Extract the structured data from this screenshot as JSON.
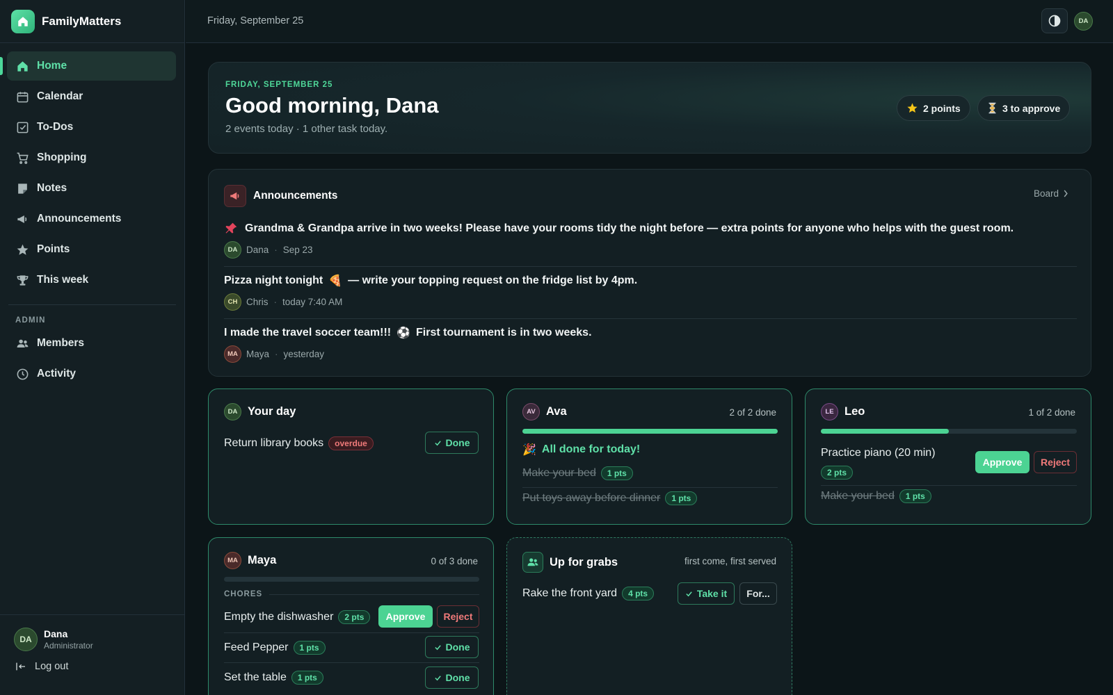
{
  "app": {
    "name": "FamilyMatters"
  },
  "topbar": {
    "date": "Friday, September 25",
    "user_initials": "DA"
  },
  "nav": {
    "items": [
      {
        "label": "Home",
        "icon": "home-icon",
        "active": true
      },
      {
        "label": "Calendar",
        "icon": "calendar-icon"
      },
      {
        "label": "To-Dos",
        "icon": "checkbox-icon"
      },
      {
        "label": "Shopping",
        "icon": "cart-icon"
      },
      {
        "label": "Notes",
        "icon": "note-icon"
      },
      {
        "label": "Announcements",
        "icon": "megaphone-icon"
      },
      {
        "label": "Points",
        "icon": "star-icon"
      },
      {
        "label": "This week",
        "icon": "trophy-icon"
      }
    ],
    "admin_label": "ADMIN",
    "admin_items": [
      {
        "label": "Members",
        "icon": "users-icon"
      },
      {
        "label": "Activity",
        "icon": "clock-icon"
      }
    ]
  },
  "user": {
    "initials": "DA",
    "name": "Dana",
    "role": "Administrator",
    "logout": "Log out"
  },
  "hero": {
    "kicker": "FRIDAY, SEPTEMBER 25",
    "title": "Good morning, Dana",
    "subtitle": "2 events today · 1 other task today.",
    "points": "2 points",
    "approve": "3 to approve"
  },
  "announcements": {
    "title": "Announcements",
    "board_link": "Board",
    "items": [
      {
        "pinned": true,
        "text": "Grandma & Grandpa arrive in two weeks! Please have your rooms tidy the night before — extra points for anyone who helps with the guest room.",
        "initials": "DA",
        "author": "Dana",
        "time": "Sep 23"
      },
      {
        "text_before": "Pizza night tonight",
        "emoji": "🍕",
        "text_after": "— write your topping request on the fridge list by 4pm.",
        "initials": "CH",
        "author": "Chris",
        "time": "today 7:40 AM"
      },
      {
        "text_before": "I made the travel soccer team!!!",
        "emoji": "⚽",
        "text_after": "First tournament is in two weeks.",
        "initials": "MA",
        "author": "Maya",
        "time": "yesterday"
      }
    ]
  },
  "your_day": {
    "initials": "DA",
    "title": "Your day",
    "task": "Return library books",
    "badge": "overdue",
    "done_label": "Done"
  },
  "ava": {
    "initials": "AV",
    "name": "Ava",
    "count": "2 of 2 done",
    "progress": 1.0,
    "all_done": "All done for today!",
    "tasks": [
      {
        "name": "Make your bed",
        "pts": "1 pts"
      },
      {
        "name": "Put toys away before dinner",
        "pts": "1 pts"
      }
    ]
  },
  "leo": {
    "initials": "LE",
    "name": "Leo",
    "count": "1 of 2 done",
    "progress": 0.5,
    "pending": {
      "name": "Practice piano (20 min)",
      "pts": "2 pts"
    },
    "approve": "Approve",
    "reject": "Reject",
    "done_task": {
      "name": "Make your bed",
      "pts": "1 pts"
    }
  },
  "maya": {
    "initials": "MA",
    "name": "Maya",
    "count": "0 of 3 done",
    "progress": 0.0,
    "section": "CHORES",
    "tasks": [
      {
        "name": "Empty the dishwasher",
        "pts": "2 pts",
        "approve": "Approve",
        "reject": "Reject"
      },
      {
        "name": "Feed Pepper",
        "pts": "1 pts",
        "done": "Done"
      },
      {
        "name": "Set the table",
        "pts": "1 pts",
        "done": "Done"
      }
    ]
  },
  "grabs": {
    "title": "Up for grabs",
    "note": "first come, first served",
    "task": "Rake the front yard",
    "pts": "4 pts",
    "take": "Take it",
    "for": "For..."
  },
  "colors": {
    "accent": "#4cd393",
    "danger": "#f07a7a",
    "bg": "#0c1518"
  }
}
